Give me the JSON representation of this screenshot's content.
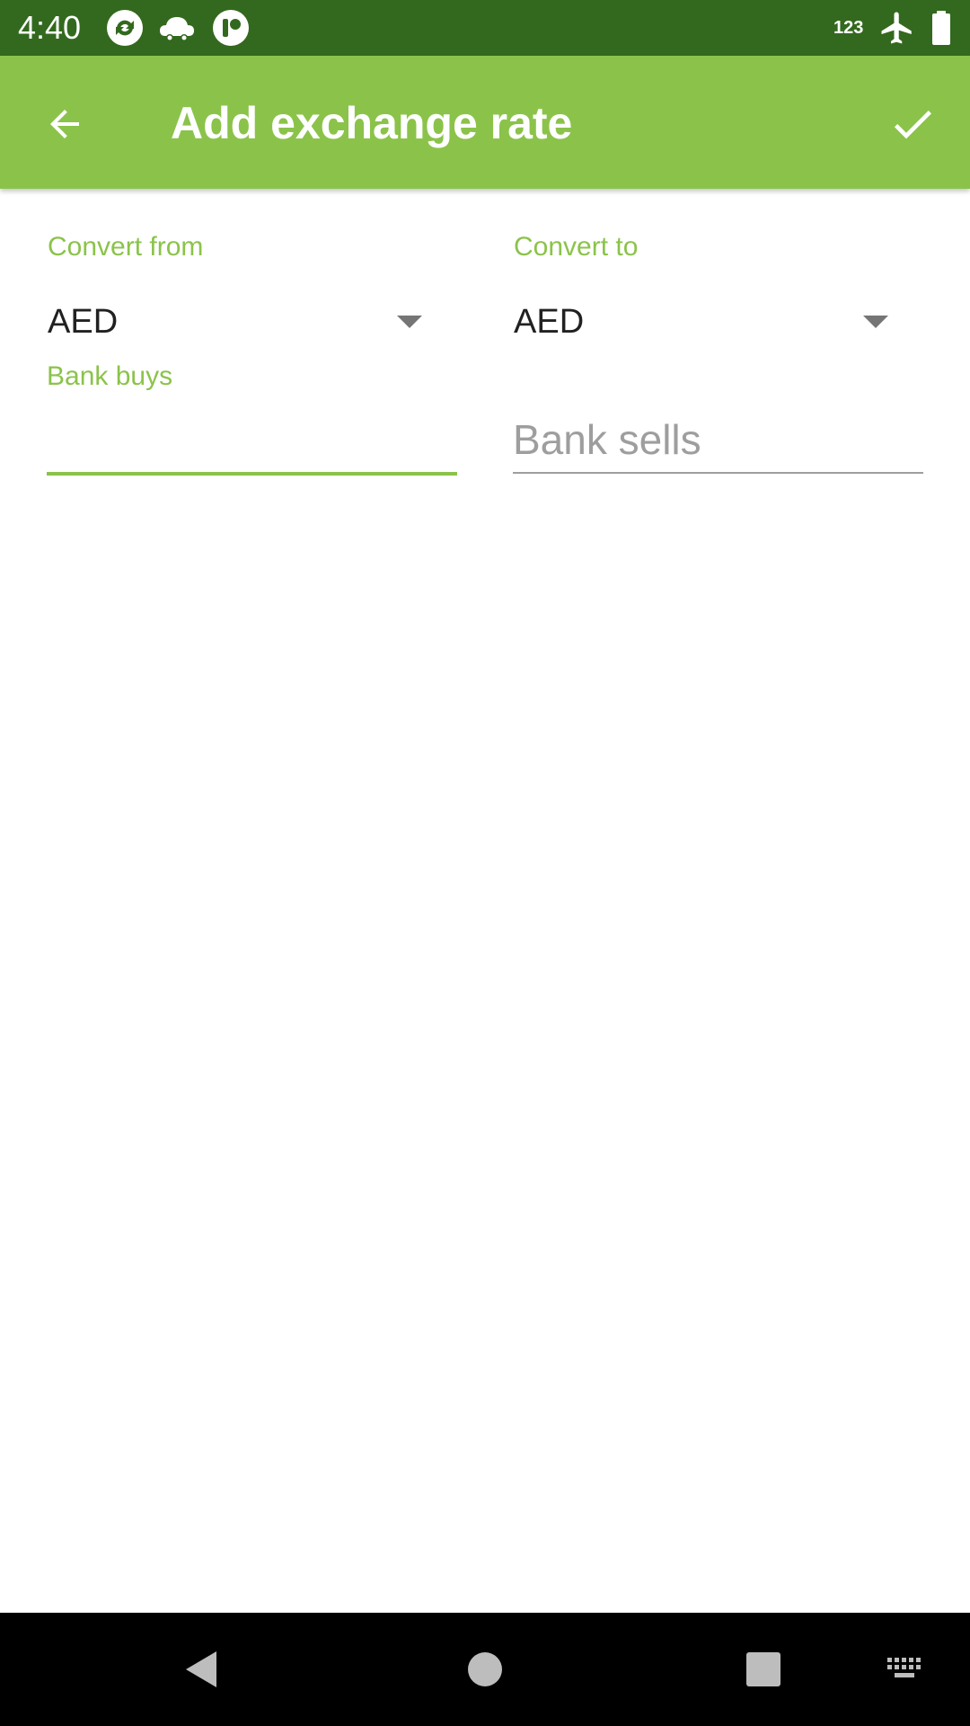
{
  "status_bar": {
    "time": "4:40",
    "network_label": "123",
    "icons": [
      "sync-icon",
      "cloud-car-icon",
      "app-notification-icon",
      "airplane-mode-icon",
      "battery-icon"
    ]
  },
  "app_bar": {
    "title": "Add exchange rate",
    "back_icon": "arrow-back-icon",
    "confirm_icon": "check-icon"
  },
  "form": {
    "convert_from": {
      "label": "Convert from",
      "value": "AED"
    },
    "convert_to": {
      "label": "Convert to",
      "value": "AED"
    },
    "bank_buys": {
      "label": "Bank buys",
      "value": ""
    },
    "bank_sells": {
      "placeholder": "Bank sells",
      "value": ""
    }
  },
  "nav_bar": {
    "buttons": [
      "back-triangle-icon",
      "home-circle-icon",
      "recents-square-icon",
      "keyboard-icon"
    ]
  },
  "colors": {
    "status_bar": "#33691e",
    "accent": "#8bc34a",
    "text_primary": "#212121",
    "hint": "#9e9e9e"
  }
}
